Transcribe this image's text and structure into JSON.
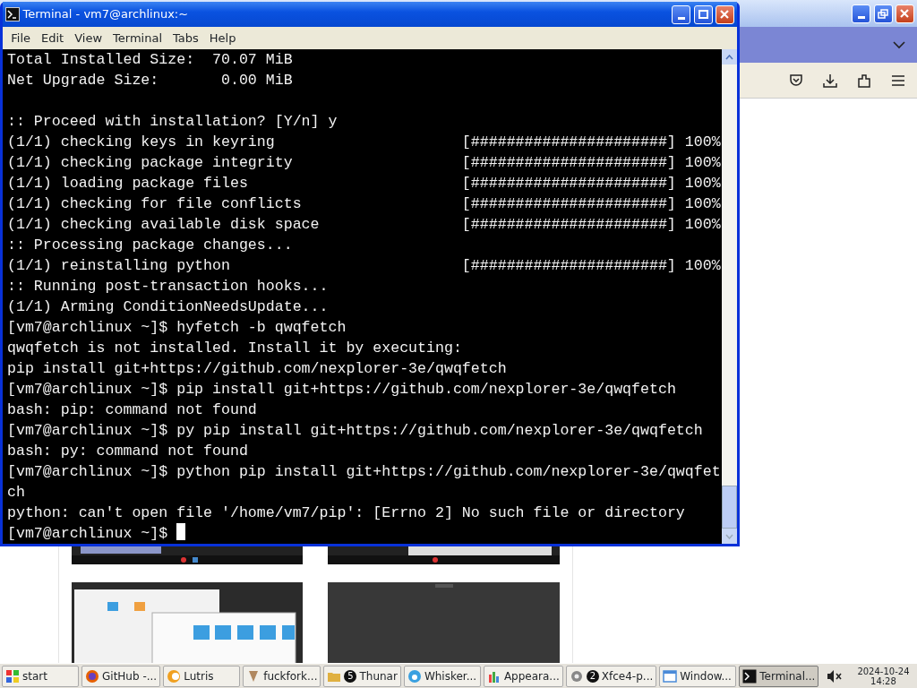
{
  "terminal": {
    "title": "Terminal - vm7@archlinux:~",
    "menu": [
      "File",
      "Edit",
      "View",
      "Terminal",
      "Tabs",
      "Help"
    ],
    "lines": [
      {
        "kind": "text",
        "text": "Total Installed Size:  70.07 MiB"
      },
      {
        "kind": "text",
        "text": "Net Upgrade Size:       0.00 MiB"
      },
      {
        "kind": "blank"
      },
      {
        "kind": "text",
        "text": ":: Proceed with installation? [Y/n] y"
      },
      {
        "kind": "progress",
        "text": "(1/1) checking keys in keyring",
        "bar": "[######################]",
        "percent": "100%"
      },
      {
        "kind": "progress",
        "text": "(1/1) checking package integrity",
        "bar": "[######################]",
        "percent": "100%"
      },
      {
        "kind": "progress",
        "text": "(1/1) loading package files",
        "bar": "[######################]",
        "percent": "100%"
      },
      {
        "kind": "progress",
        "text": "(1/1) checking for file conflicts",
        "bar": "[######################]",
        "percent": "100%"
      },
      {
        "kind": "progress",
        "text": "(1/1) checking available disk space",
        "bar": "[######################]",
        "percent": "100%"
      },
      {
        "kind": "text",
        "text": ":: Processing package changes..."
      },
      {
        "kind": "progress",
        "text": "(1/1) reinstalling python",
        "bar": "[######################]",
        "percent": "100%"
      },
      {
        "kind": "text",
        "text": ":: Running post-transaction hooks..."
      },
      {
        "kind": "text",
        "text": "(1/1) Arming ConditionNeedsUpdate..."
      },
      {
        "kind": "text",
        "text": "[vm7@archlinux ~]$ hyfetch -b qwqfetch"
      },
      {
        "kind": "text",
        "text": "qwqfetch is not installed. Install it by executing:"
      },
      {
        "kind": "text",
        "text": "pip install git+https://github.com/nexplorer-3e/qwqfetch"
      },
      {
        "kind": "text",
        "text": "[vm7@archlinux ~]$ pip install git+https://github.com/nexplorer-3e/qwqfetch"
      },
      {
        "kind": "text",
        "text": "bash: pip: command not found"
      },
      {
        "kind": "text",
        "text": "[vm7@archlinux ~]$ py pip install git+https://github.com/nexplorer-3e/qwqfetch"
      },
      {
        "kind": "text",
        "text": "bash: py: command not found"
      },
      {
        "kind": "text",
        "text": "[vm7@archlinux ~]$ python pip install git+https://github.com/nexplorer-3e/qwqfet"
      },
      {
        "kind": "text",
        "text": "ch"
      },
      {
        "kind": "text",
        "text": "python: can't open file '/home/vm7/pip': [Errno 2] No such file or directory"
      },
      {
        "kind": "prompt",
        "text": "[vm7@archlinux ~]$ "
      }
    ]
  },
  "taskbar": {
    "start": "start",
    "tasks": [
      {
        "label": "GitHub -...",
        "selected": false
      },
      {
        "label": "Lutris",
        "selected": false
      },
      {
        "label": "fuckfork...",
        "selected": false
      },
      {
        "label": "Thunar",
        "count": "5",
        "selected": false
      },
      {
        "label": "Whisker...",
        "selected": false
      },
      {
        "label": "Appeara...",
        "selected": false
      },
      {
        "label": "Xfce4-p...",
        "count": "2",
        "selected": false
      },
      {
        "label": "Window...",
        "selected": false
      },
      {
        "label": "Terminal...",
        "selected": true
      }
    ],
    "date": "2024-10-24",
    "time": "14:28"
  }
}
